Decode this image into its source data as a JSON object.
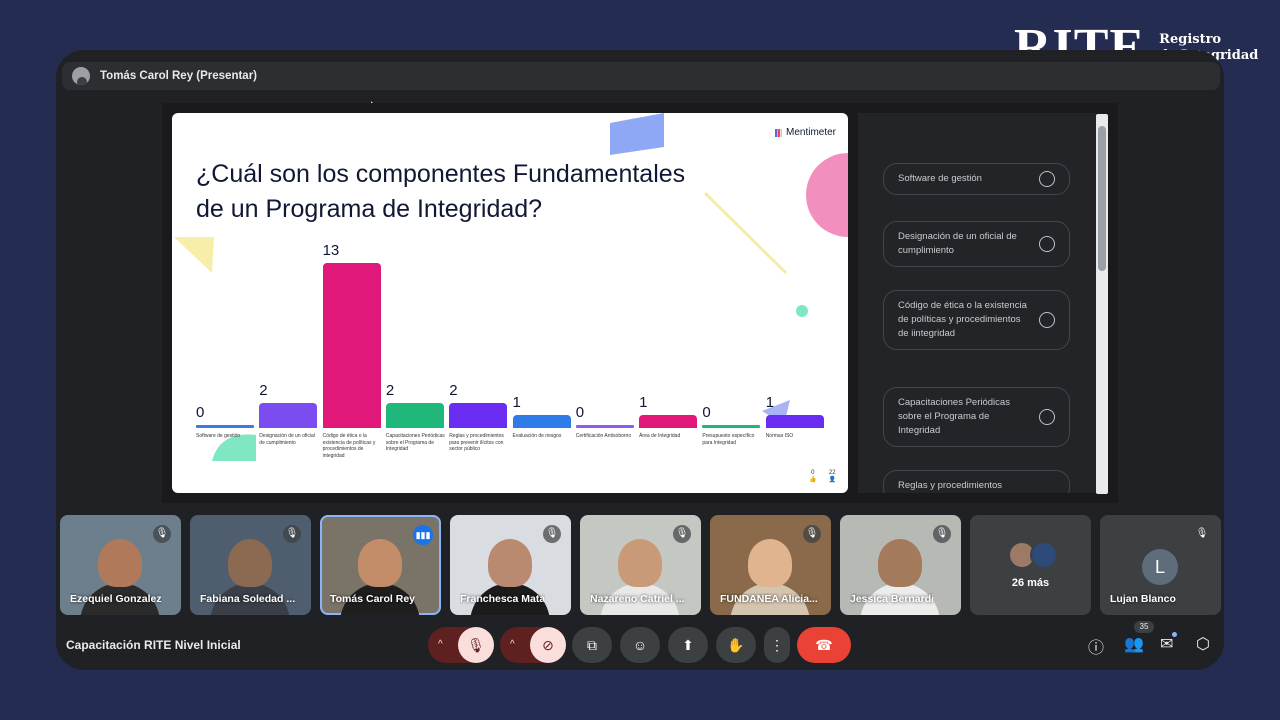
{
  "brand": {
    "logo": "RITE",
    "sub_line1": "Registro",
    "sub_line2": "de Integridad"
  },
  "presenter": {
    "name": "Tomás Carol Rey (Presentar)"
  },
  "slide": {
    "brand": "Mentimeter",
    "title_line1": "¿Cuál son los componentes Fundamentales",
    "title_line2": "de un Programa de Integridad?",
    "reactions": {
      "likes": "0",
      "people": "22"
    }
  },
  "chart_data": {
    "type": "bar",
    "categories": [
      "Software de gestión",
      "Designación de un oficial de cumplimiento",
      "Código de ética o la existencia de políticas y procedimientos de integridad",
      "Capacitaciones Periódicas sobre el Programa de Integridad",
      "Reglas y procedimientos para prevenir ilícitos con sector público",
      "Evaluación de riesgos",
      "Certificación Antisoborno",
      "Área de Integridad",
      "Presupuesto específico para Integridad",
      "Normas ISO"
    ],
    "values": [
      0,
      2,
      13,
      2,
      2,
      1,
      0,
      1,
      0,
      1
    ],
    "value_labels": [
      "0",
      "2",
      "13",
      "2",
      "2",
      "1",
      "0",
      "1",
      "0",
      "1"
    ],
    "colors": [
      "#3a7be8",
      "#7b4df0",
      "#e0187a",
      "#1fb87a",
      "#6a2cf0",
      "#2f7be8",
      "#8a5cf5",
      "#e0187a",
      "#1fb87a",
      "#6a2cf0"
    ],
    "ylim": [
      0,
      13
    ]
  },
  "options": [
    {
      "label": "Software de gestión"
    },
    {
      "label": "Designación de un oficial de cumplimiento"
    },
    {
      "label": "Código de ética o la existencia de políticas y procedimientos de iintegridad"
    },
    {
      "label": "Capacitaciones Periódicas sobre el Programa de Integridad"
    },
    {
      "label": "Reglas y procedimientos"
    }
  ],
  "participants": [
    {
      "name": "Ezequiel Gonzalez"
    },
    {
      "name": "Fabiana Soledad ..."
    },
    {
      "name": "Tomás Carol Rey"
    },
    {
      "name": "Franchesca Mata"
    },
    {
      "name": "Nazareno Catriel ..."
    },
    {
      "name": "FUNDANEA Alicia..."
    },
    {
      "name": "Jessica Bernardi"
    },
    {
      "name": "26 más"
    },
    {
      "name": "Lujan Blanco",
      "initial": "L"
    }
  ],
  "meeting": {
    "title": "Capacitación RITE Nivel Inicial",
    "participant_count": "35"
  }
}
